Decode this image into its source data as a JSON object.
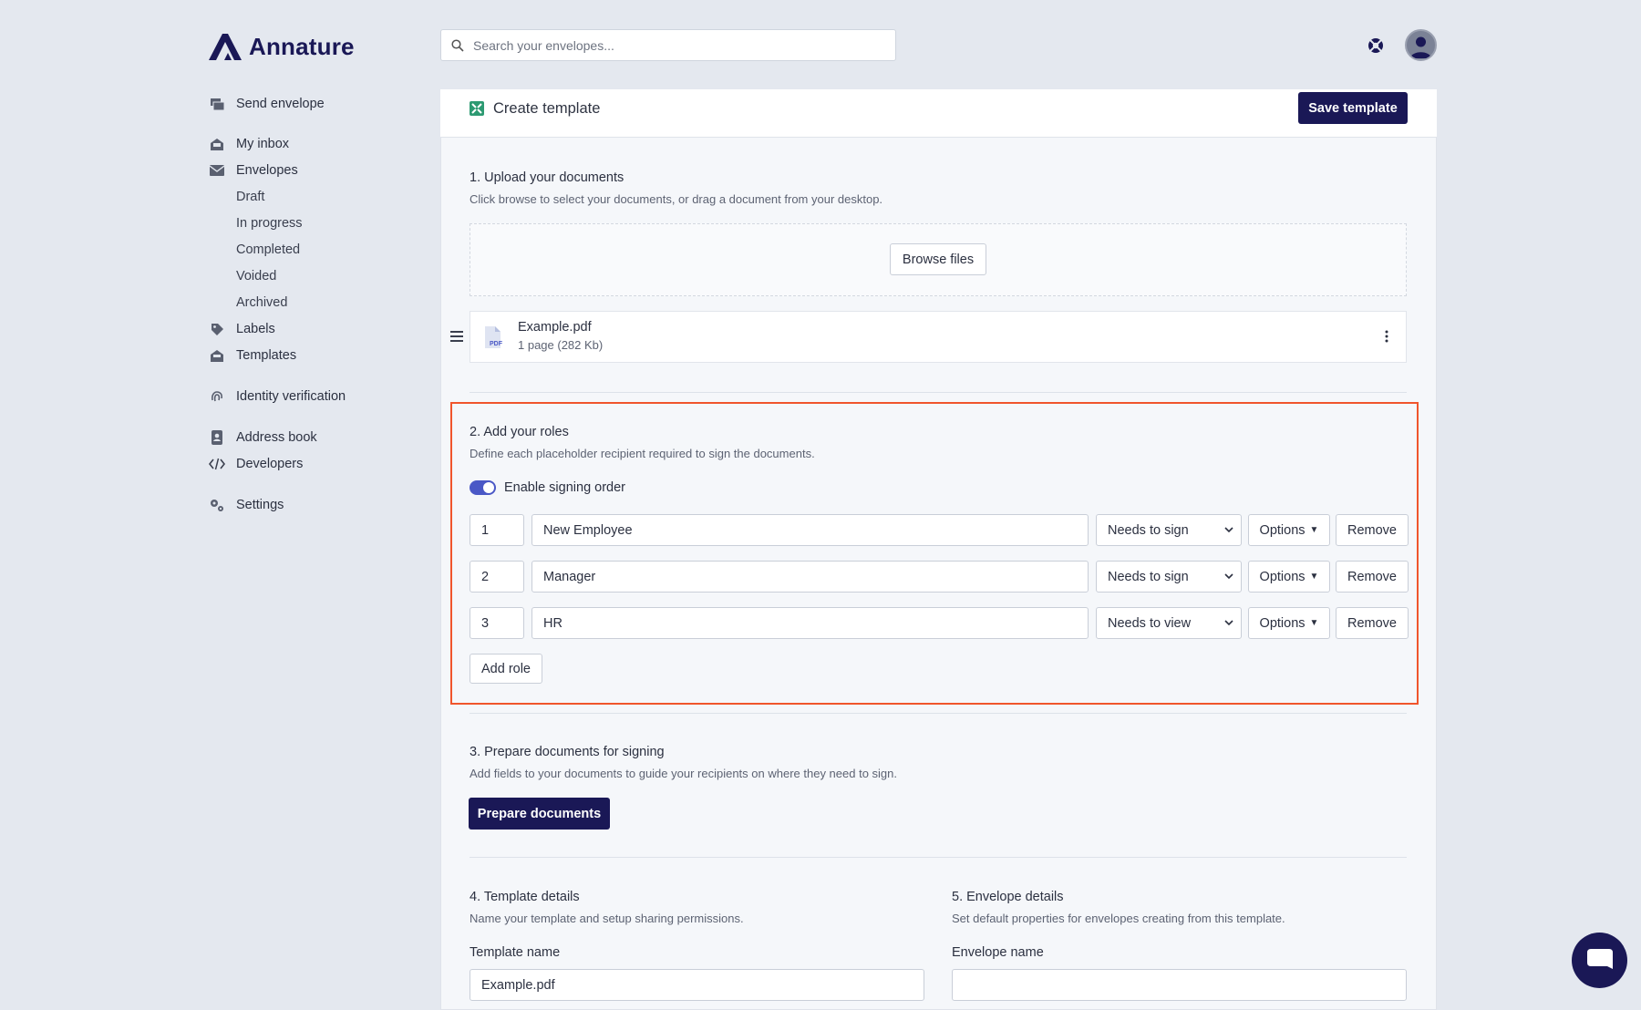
{
  "app": {
    "logo_text": "Annature",
    "brand_color": "#1a1856",
    "accent_color": "#f0552c"
  },
  "header": {
    "search_placeholder": "Search your envelopes...",
    "help_icon": "help-icon",
    "avatar_icon": "user-avatar-icon"
  },
  "sidebar": {
    "send_envelope": "Send envelope",
    "my_inbox": "My inbox",
    "envelopes": "Envelopes",
    "envelope_subitems": [
      "Draft",
      "In progress",
      "Completed",
      "Voided",
      "Archived"
    ],
    "labels": "Labels",
    "templates": "Templates",
    "identity_verification": "Identity verification",
    "address_book": "Address book",
    "developers": "Developers",
    "settings": "Settings"
  },
  "page": {
    "title": "Create template",
    "save_button": "Save template"
  },
  "section1": {
    "title": "1. Upload your documents",
    "desc": "Click browse to select your documents, or drag a document from your desktop.",
    "browse_button": "Browse files",
    "file": {
      "name": "Example.pdf",
      "meta": "1 page (282 Kb)",
      "type_label": "PDF"
    }
  },
  "section2": {
    "title": "2. Add your roles",
    "desc": "Define each placeholder recipient required to sign the documents.",
    "signing_order_label": "Enable signing order",
    "signing_order_enabled": true,
    "roles": [
      {
        "order": "1",
        "name": "New Employee",
        "action": "Needs to sign"
      },
      {
        "order": "2",
        "name": "Manager",
        "action": "Needs to sign"
      },
      {
        "order": "3",
        "name": "HR",
        "action": "Needs to view"
      }
    ],
    "options_label": "Options",
    "remove_label": "Remove",
    "add_role_button": "Add role"
  },
  "section3": {
    "title": "3. Prepare documents for signing",
    "desc": "Add fields to your documents to guide your recipients on where they need to sign.",
    "button": "Prepare documents"
  },
  "section4": {
    "title": "4. Template details",
    "desc": "Name your template and setup sharing permissions.",
    "field_label": "Template name",
    "field_value": "Example.pdf"
  },
  "section5": {
    "title": "5. Envelope details",
    "desc": "Set default properties for envelopes creating from this template.",
    "field_label": "Envelope name",
    "field_value": ""
  }
}
